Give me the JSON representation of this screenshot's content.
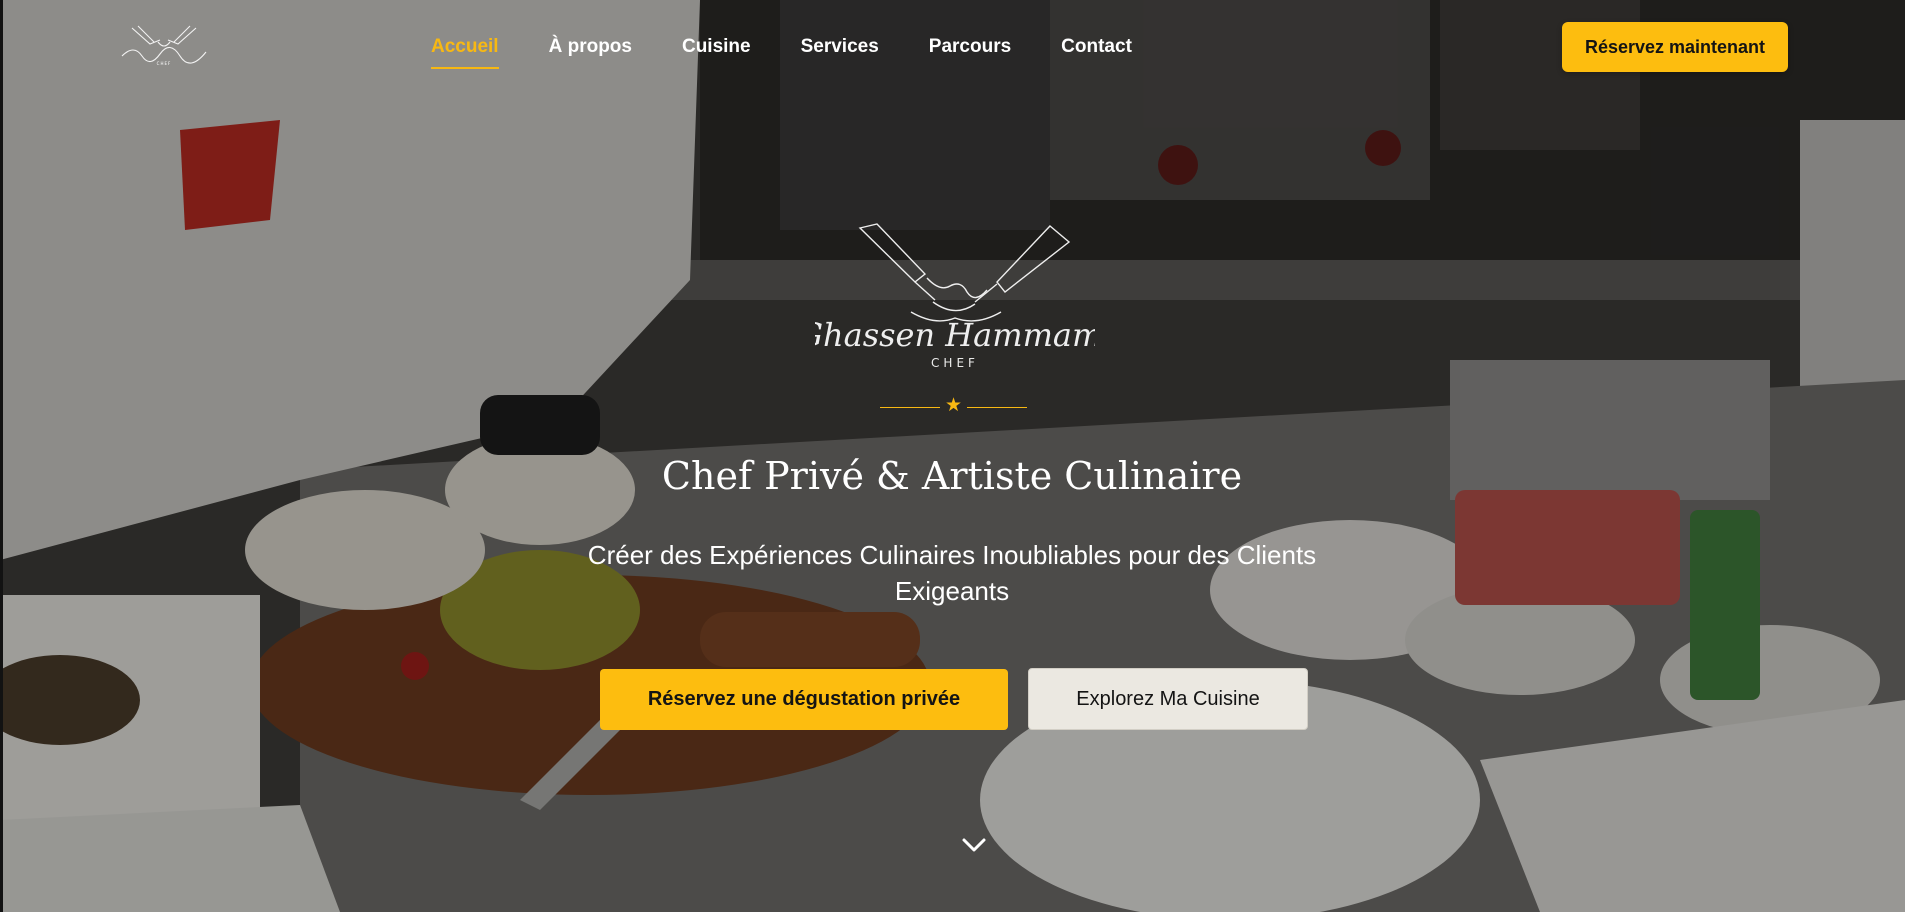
{
  "logo": {
    "small_icon": "crossed-knives-logo-icon",
    "text": "Ghassen Hammami",
    "tagline": "CHEF"
  },
  "nav": {
    "items": [
      {
        "label": "Accueil",
        "active": true
      },
      {
        "label": "À propos",
        "active": false
      },
      {
        "label": "Cuisine",
        "active": false
      },
      {
        "label": "Services",
        "active": false
      },
      {
        "label": "Parcours",
        "active": false
      },
      {
        "label": "Contact",
        "active": false
      }
    ],
    "cta_label": "Réservez maintenant"
  },
  "hero": {
    "divider_icon": "star-icon",
    "headline": "Chef Privé & Artiste Culinaire",
    "subtitle": "Créer des Expériences Culinaires Inoubliables pour des Clients Exigeants",
    "primary_button": "Réservez une dégustation privée",
    "secondary_button": "Explorez Ma Cuisine",
    "scroll_icon": "chevron-down-icon"
  },
  "colors": {
    "accent": "#fdbd0f",
    "nav_active": "#f7b813",
    "text_light": "#ffffff",
    "secondary_button_bg": "#ebe8e1"
  }
}
